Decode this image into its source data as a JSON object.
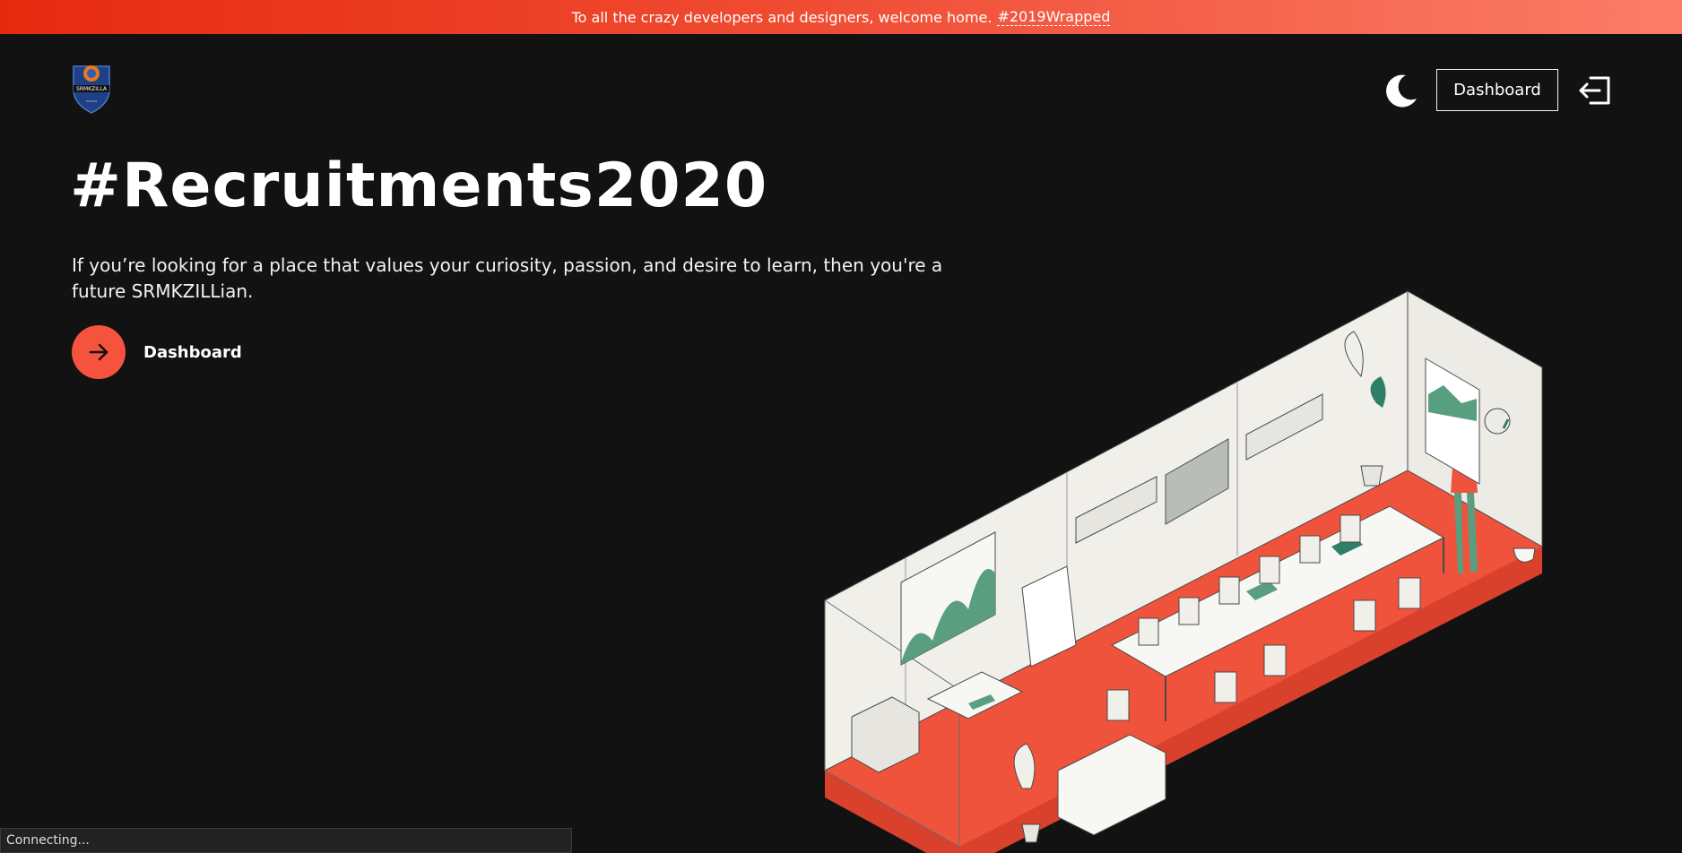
{
  "banner": {
    "text": "To all the crazy developers and designers, welcome home.",
    "hashtag": "#2019Wrapped"
  },
  "logo": {
    "name": "SRMKZILLA",
    "sub": "mozilla"
  },
  "header": {
    "theme_toggle_icon": "moon-icon",
    "dashboard_label": "Dashboard",
    "logout_icon": "logout-icon"
  },
  "hero": {
    "title": "#Recruitments2020",
    "subtitle": "If you’re looking for a place that values your curiosity, passion, and desire to learn, then you're a future SRMKZILLian.",
    "cta_label": "Dashboard",
    "cta_icon": "arrow-right-icon"
  },
  "status": {
    "text": "Connecting..."
  },
  "colors": {
    "accent": "#f5533d",
    "background": "#121212",
    "room_floor": "#f0533c",
    "chart_green": "#5a9e80"
  }
}
